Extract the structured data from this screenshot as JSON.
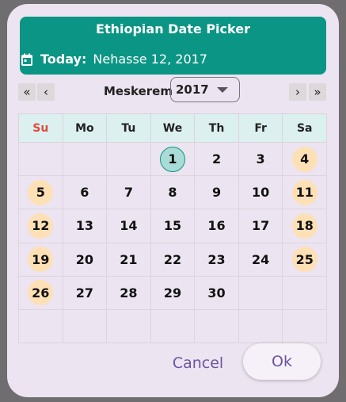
{
  "header": {
    "title": "Ethiopian Date Picker",
    "today_label": "Today:",
    "today_value": "Nehasse 12, 2017",
    "icon": "calendar-icon"
  },
  "nav": {
    "prev_year_symbol": "«",
    "prev_month_symbol": "‹",
    "next_month_symbol": "›",
    "next_year_symbol": "»",
    "month": "Meskerem",
    "year": "2017"
  },
  "weekdays": [
    "Su",
    "Mo",
    "Tu",
    "We",
    "Th",
    "Fr",
    "Sa"
  ],
  "days": [
    [
      "",
      "",
      "",
      "1",
      "2",
      "3",
      "4"
    ],
    [
      "5",
      "6",
      "7",
      "8",
      "9",
      "10",
      "11"
    ],
    [
      "12",
      "13",
      "14",
      "15",
      "16",
      "17",
      "18"
    ],
    [
      "19",
      "20",
      "21",
      "22",
      "23",
      "24",
      "25"
    ],
    [
      "26",
      "27",
      "28",
      "29",
      "30",
      "",
      ""
    ],
    [
      "",
      "",
      "",
      "",
      "",
      "",
      ""
    ]
  ],
  "highlighted_day": "1",
  "colors": {
    "header": "#0a9584",
    "weekend": "#fde0b5",
    "selected": "#a9dcd7",
    "sunday_label": "#e04a3a",
    "button_text": "#6c54a3"
  },
  "actions": {
    "cancel": "Cancel",
    "ok": "Ok"
  }
}
